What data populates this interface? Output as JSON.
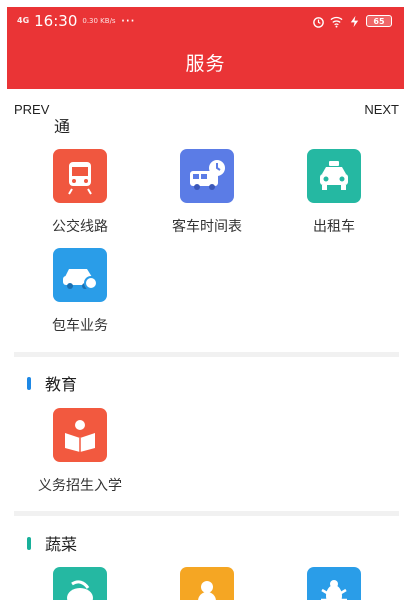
{
  "status_bar": {
    "signal": "4G",
    "time": "16:30",
    "speed": "0.30 KB/s",
    "dots": "···",
    "battery": "65"
  },
  "header": {
    "title": "服务"
  },
  "nav": {
    "prev": "PREV",
    "next": "NEXT"
  },
  "sections": [
    {
      "title": "交通",
      "visible_title": "通",
      "accent": "#f2423a",
      "items": [
        {
          "label": "公交线路",
          "icon": "bus-icon",
          "color": "#f0573f"
        },
        {
          "label": "客车时间表",
          "icon": "coach-clock-icon",
          "color": "#5b7ce6"
        },
        {
          "label": "出租车",
          "icon": "taxi-icon",
          "color": "#25b8a2"
        },
        {
          "label": "包车业务",
          "icon": "car-rental-icon",
          "color": "#2a9de8"
        }
      ]
    },
    {
      "title": "教育",
      "accent": "#1e88e5",
      "items": [
        {
          "label": "义务招生入学",
          "icon": "reading-student-icon",
          "color": "#f2593f"
        }
      ]
    },
    {
      "title": "蔬菜",
      "accent": "#18b09a",
      "items": [
        {
          "label": "",
          "icon": "vegetable-icon",
          "color": "#25b8a2"
        },
        {
          "label": "",
          "icon": "gourd-icon",
          "color": "#f5a623"
        },
        {
          "label": "",
          "icon": "bug-icon",
          "color": "#2a9de8"
        }
      ]
    }
  ]
}
